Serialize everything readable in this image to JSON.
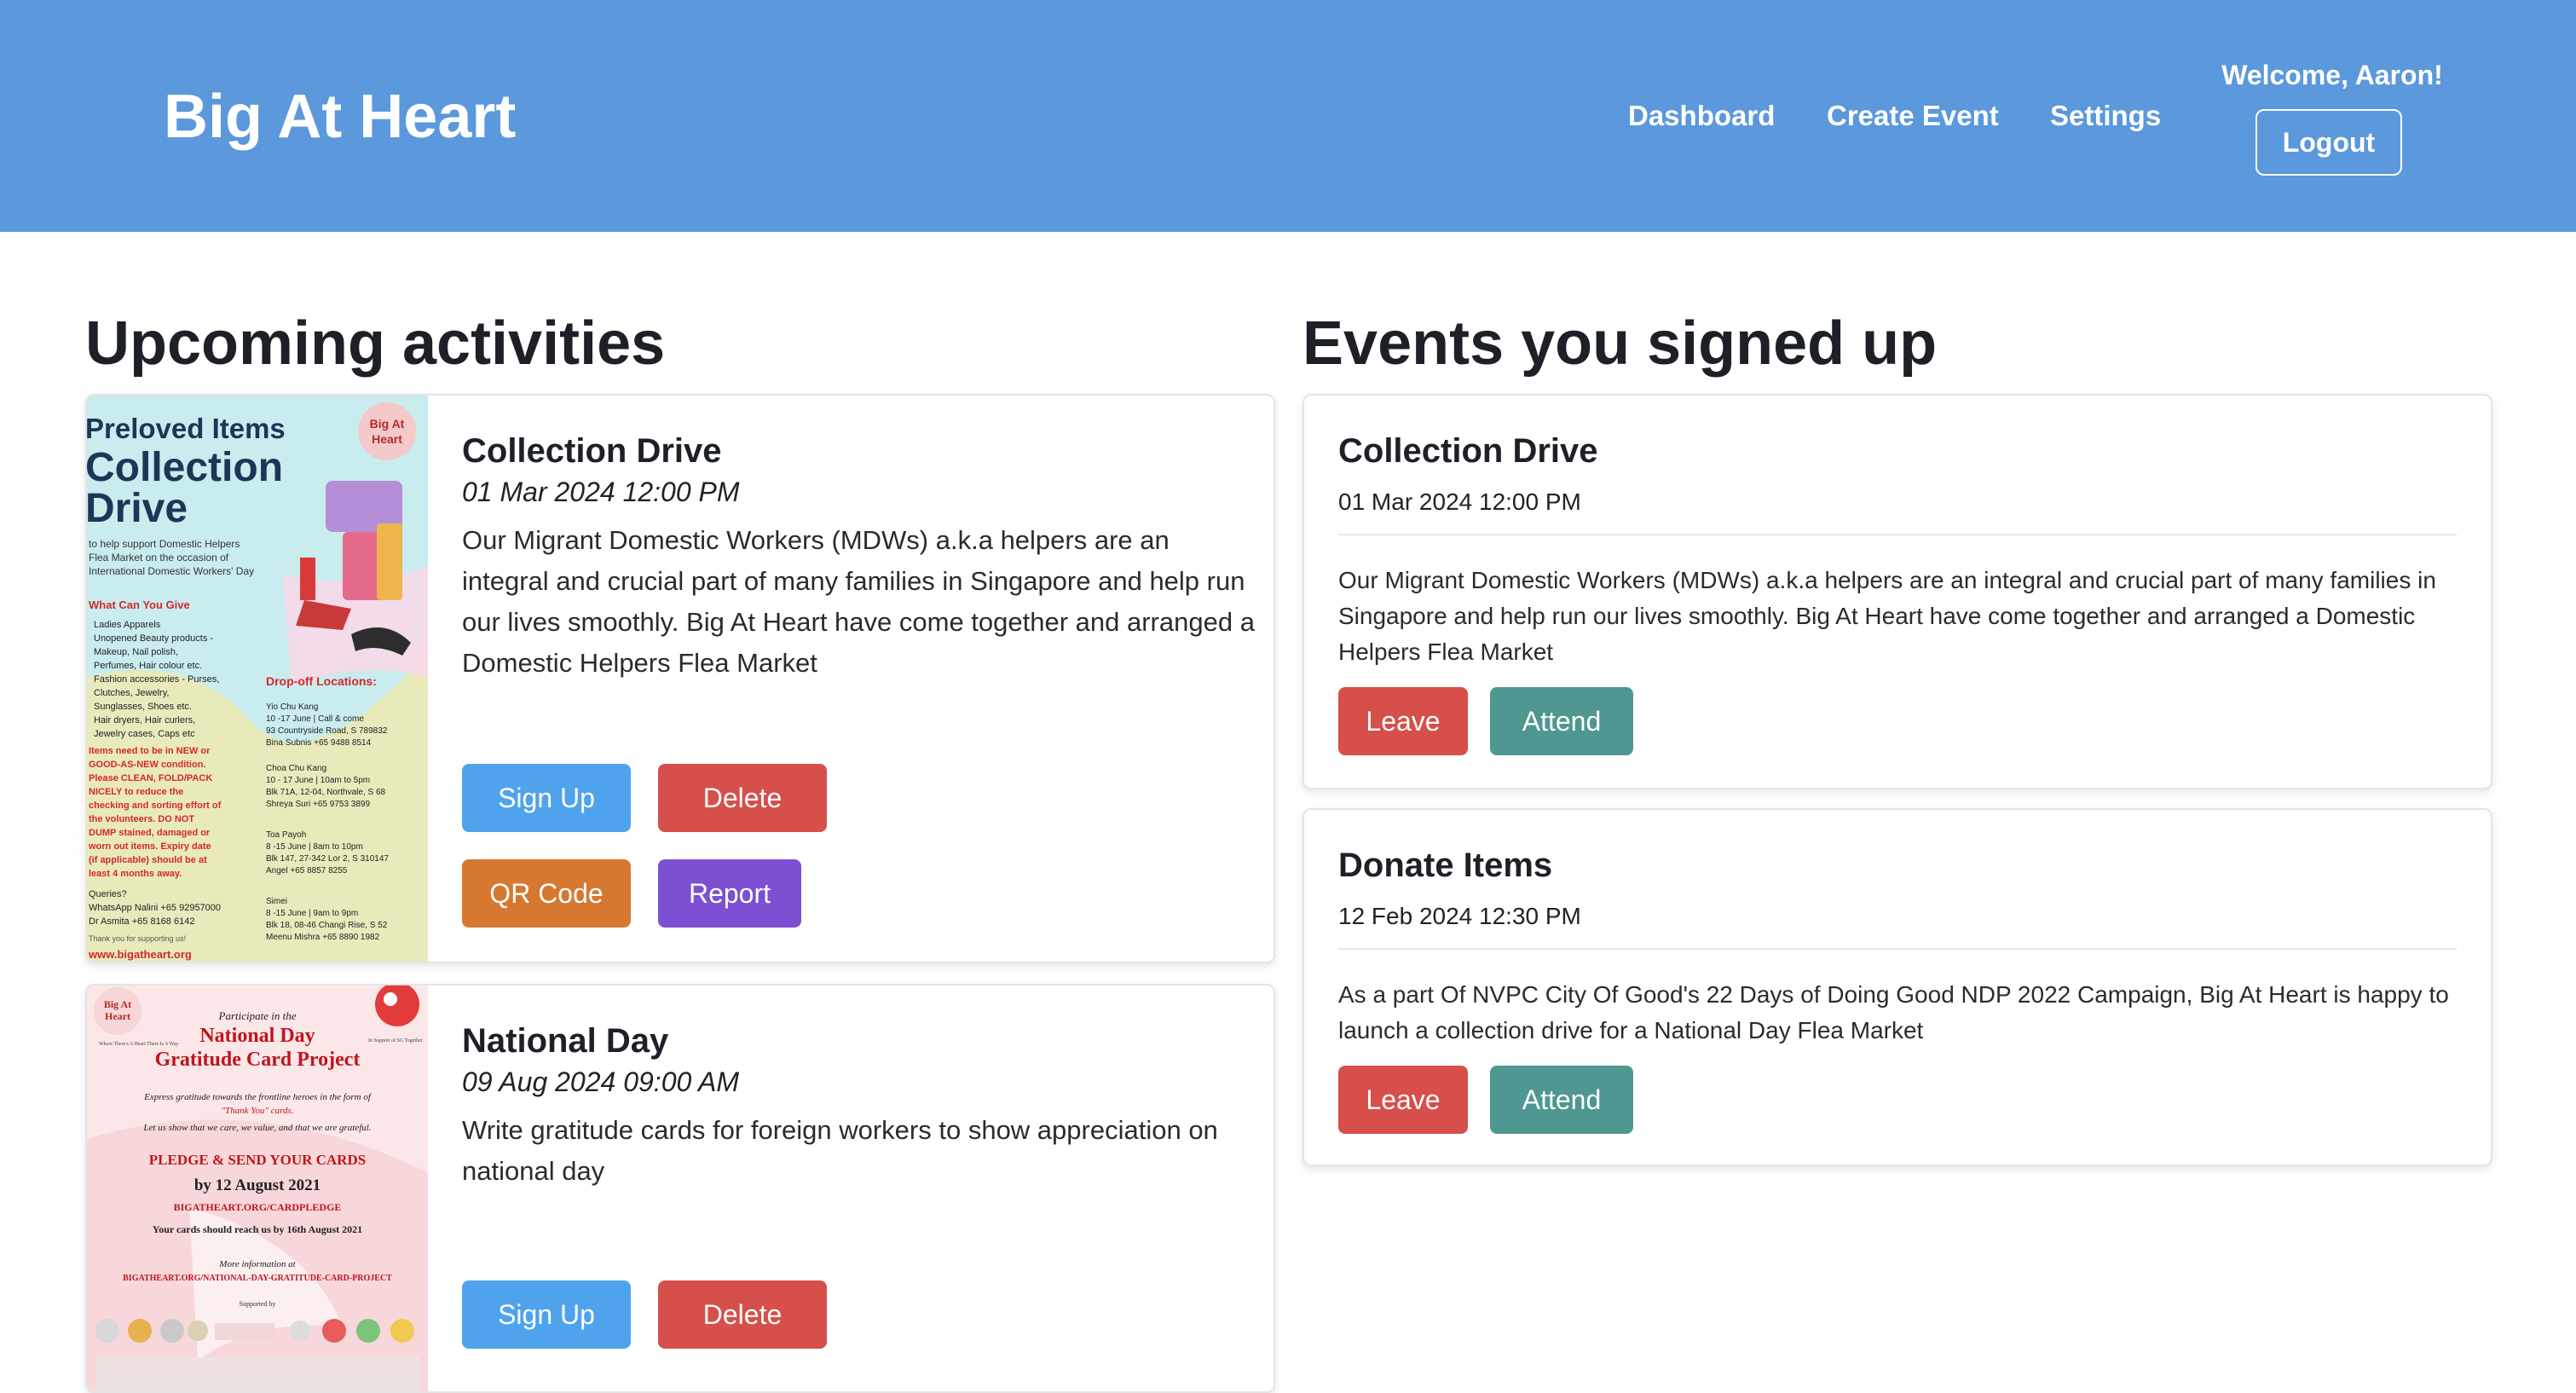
{
  "header": {
    "brand": "Big At Heart",
    "nav": {
      "dashboard": "Dashboard",
      "create_event": "Create Event",
      "settings": "Settings"
    },
    "welcome": "Welcome, Aaron!",
    "logout": "Logout"
  },
  "upcoming": {
    "title": "Upcoming activities",
    "events": [
      {
        "title": "Collection Drive",
        "date": "01 Mar 2024 12:00 PM",
        "description": "Our Migrant Domestic Workers (MDWs) a.k.a helpers are an integral and crucial part of many families in Singapore and help run our lives smoothly. Big At Heart have come together and arranged a Domestic Helpers Flea Market",
        "buttons": {
          "sign_up": "Sign Up",
          "delete": "Delete",
          "qr_code": "QR Code",
          "report": "Report"
        },
        "poster": {
          "heading1": "Preloved Items",
          "heading2": "Collection",
          "heading3": "Drive",
          "badge": "Big At Heart",
          "sub": "to help support Domestic Helpers Flea Market on the occasion of International Domestic Workers' Day",
          "give_title": "What Can You Give",
          "give_list": "Ladies Apparels\nUnopened Beauty products - Makeup, Nail polish, Perfumes, Hair colour etc.\nFashion accessories - Purses, Clutches, Jewelry, Sunglasses, Shoes etc.\nHair dryers, Hair curlers, Jewelry cases, Caps etc",
          "dropoff_title": "Drop-off Locations:",
          "dropoff_list": "Yio Chu Kang\n10 -17 June | Call & come\n93 Countryside Road, S 789832\nBina Subnis +65 9488 8514\n\nChoa Chu Kang\n10 - 17 June | 10am to 5pm\nBlk 71A, 12-04, Northvale, S 68\nShreya Suri +65 9753 3899\n\nToa Payoh\n8 -15 June | 8am to 10pm\nBlk 147, 27-342 Lor 2, S 310147\nAngel +65 8857 8255\n\nSimei\n8 -15 June | 9am to 9pm\nBlk 18, 08-46 Changi Rise, S 52\nMeenu Mishra +65 8890 1982",
          "notice": "Items need to be in NEW or GOOD-AS-NEW condition. Please CLEAN, FOLD/PACK NICELY to reduce the checking and sorting effort of the volunteers. DO NOT DUMP stained, damaged or worn out items. Expiry date (if applicable) should be at least 4 months away.",
          "queries": "Queries?\nWhatsApp Nalini +65 92957000\nDr Asmita +65 8168 6142",
          "thanks": "Thank you for supporting us!",
          "url": "www.bigatheart.org"
        }
      },
      {
        "title": "National Day",
        "date": "09 Aug 2024 09:00 AM",
        "description": "Write gratitude cards for foreign workers to show appreciation on national day",
        "buttons": {
          "sign_up": "Sign Up",
          "delete": "Delete"
        },
        "poster": {
          "badge": "Big At Heart",
          "participate": "Participate in the",
          "title1": "National Day",
          "title2": "Gratitude Card Project",
          "left_tag": "Where There's A Heart There Is A Way",
          "right_tag": "In Support of SG Together",
          "line1": "Express gratitude towards the frontline heroes in the form of \"Thank You\" cards.",
          "line2": "Let us show that we care, we value, and that we are grateful.",
          "pledge": "PLEDGE & SEND YOUR CARDS",
          "by_date": "by 12 August 2021",
          "url1": "BIGATHEART.ORG/CARDPLEDGE",
          "reach": "Your cards should reach us by 16th August 2021",
          "more": "More information at",
          "url2": "BIGATHEART.ORG/NATIONAL-DAY-GRATITUDE-CARD-PROJECT",
          "supported": "Supported by"
        }
      }
    ]
  },
  "signed_up": {
    "title": "Events you signed up",
    "events": [
      {
        "title": "Collection Drive",
        "date": "01 Mar 2024 12:00 PM",
        "description": "Our Migrant Domestic Workers (MDWs) a.k.a helpers are an integral and crucial part of many families in Singapore and help run our lives smoothly. Big At Heart have come together and arranged a Domestic Helpers Flea Market",
        "buttons": {
          "leave": "Leave",
          "attend": "Attend"
        }
      },
      {
        "title": "Donate Items",
        "date": "12 Feb 2024 12:30 PM",
        "description": "As a part Of NVPC City Of Good's 22 Days of Doing Good NDP 2022 Campaign, Big At Heart is happy to launch a collection drive for a National Day Flea Market",
        "buttons": {
          "leave": "Leave",
          "attend": "Attend"
        }
      }
    ]
  },
  "colors": {
    "header_bg": "#5b98dc",
    "sign_up": "#4fa3ec",
    "delete": "#d64f4a",
    "qr_code": "#d6782f",
    "report": "#7d4fd3",
    "attend": "#4f9790"
  }
}
